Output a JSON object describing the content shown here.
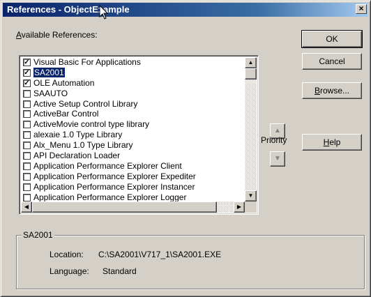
{
  "window": {
    "title": "References - ObjectExample",
    "close_glyph": "×"
  },
  "available_label": {
    "accel": "A",
    "rest": "vailable References:"
  },
  "references": [
    {
      "label": "Visual Basic For Applications",
      "checked": true,
      "selected": false
    },
    {
      "label": "SA2001",
      "checked": true,
      "selected": true
    },
    {
      "label": "OLE Automation",
      "checked": true,
      "selected": false
    },
    {
      "label": "SAAUTO",
      "checked": false,
      "selected": false
    },
    {
      "label": "Active Setup Control Library",
      "checked": false,
      "selected": false
    },
    {
      "label": "ActiveBar Control",
      "checked": false,
      "selected": false
    },
    {
      "label": "ActiveMovie control type library",
      "checked": false,
      "selected": false
    },
    {
      "label": "alexaie 1.0 Type Library",
      "checked": false,
      "selected": false
    },
    {
      "label": "Alx_Menu 1.0 Type Library",
      "checked": false,
      "selected": false
    },
    {
      "label": "API Declaration Loader",
      "checked": false,
      "selected": false
    },
    {
      "label": "Application Performance Explorer Client",
      "checked": false,
      "selected": false
    },
    {
      "label": "Application Performance Explorer Expediter",
      "checked": false,
      "selected": false
    },
    {
      "label": "Application Performance Explorer Instancer",
      "checked": false,
      "selected": false
    },
    {
      "label": "Application Performance Explorer Logger",
      "checked": false,
      "selected": false
    }
  ],
  "buttons": {
    "ok": "OK",
    "cancel": "Cancel",
    "browse_accel": "B",
    "browse_rest": "rowse...",
    "help_accel": "H",
    "help_rest": "elp"
  },
  "priority": {
    "label": "Priority",
    "up_glyph": "▲",
    "down_glyph": "▼"
  },
  "scroll": {
    "up": "▲",
    "down": "▼",
    "left": "◀",
    "right": "▶"
  },
  "details": {
    "group_title": "SA2001",
    "location_label": "Location:",
    "location_value": "C:\\SA2001\\V717_1\\SA2001.EXE",
    "language_label": "Language:",
    "language_value": "Standard"
  }
}
